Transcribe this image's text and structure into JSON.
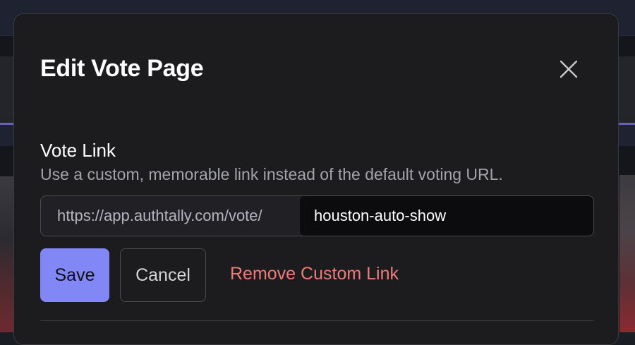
{
  "modal": {
    "title": "Edit Vote Page",
    "close_icon": "close-icon"
  },
  "vote_link": {
    "label": "Vote Link",
    "description": "Use a custom, memorable link instead of the default voting URL.",
    "url_prefix": "https://app.authtally.com/vote/",
    "slug_value": "houston-auto-show"
  },
  "actions": {
    "save_label": "Save",
    "cancel_label": "Cancel",
    "remove_label": "Remove Custom Link"
  },
  "colors": {
    "accent": "#8187f5",
    "danger": "#ef7a7a",
    "modal_bg": "#1c1c1f"
  }
}
